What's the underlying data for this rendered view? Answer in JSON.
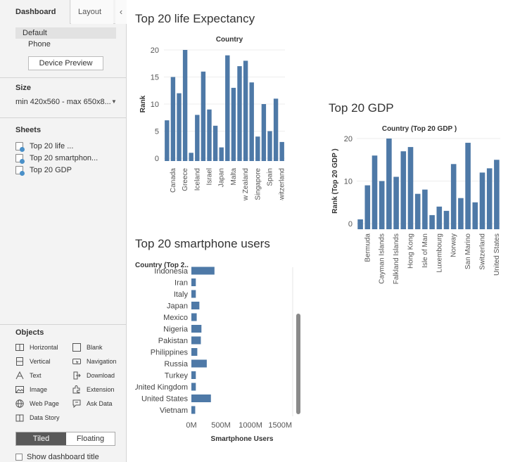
{
  "sidebar": {
    "tabs": {
      "dashboard": "Dashboard",
      "layout": "Layout",
      "collapse_glyph": "‹"
    },
    "device": {
      "default_label": "Default",
      "phone_label": "Phone",
      "preview_button": "Device Preview"
    },
    "size": {
      "title": "Size",
      "value": "min 420x560 - max 650x8...",
      "arrow": "▼"
    },
    "sheets": {
      "title": "Sheets",
      "items": [
        {
          "label": "Top 20 life ..."
        },
        {
          "label": "Top 20 smartphon..."
        },
        {
          "label": "Top 20 GDP"
        }
      ]
    },
    "objects": {
      "title": "Objects",
      "items": [
        {
          "label": "Horizontal",
          "icon": "horizontal-icon"
        },
        {
          "label": "Blank",
          "icon": "blank-icon"
        },
        {
          "label": "Vertical",
          "icon": "vertical-icon"
        },
        {
          "label": "Navigation",
          "icon": "navigation-icon"
        },
        {
          "label": "Text",
          "icon": "text-icon"
        },
        {
          "label": "Download",
          "icon": "download-icon"
        },
        {
          "label": "Image",
          "icon": "image-icon"
        },
        {
          "label": "Extension",
          "icon": "extension-icon"
        },
        {
          "label": "Web Page",
          "icon": "web-page-icon"
        },
        {
          "label": "Ask Data",
          "icon": "ask-data-icon"
        },
        {
          "label": "Data Story",
          "icon": "data-story-icon"
        }
      ]
    },
    "layout_mode": {
      "tiled": "Tiled",
      "floating": "Floating"
    },
    "show_title_label": "Show dashboard title"
  },
  "dashboard": {
    "life_title": "Top 20 life Expectancy",
    "gdp_title": "Top 20 GDP",
    "smart_title": "Top 20 smartphone users"
  },
  "colors": {
    "bar": "#4e79a7",
    "axis": "#555555",
    "grid": "#eeeeee"
  },
  "chart_data": [
    {
      "type": "bar",
      "title": "Country",
      "ylabel": "Rank",
      "ylim": [
        0,
        20
      ],
      "yticks": [
        0,
        5,
        10,
        15,
        20
      ],
      "tick_labels": [
        "Canada",
        "Greece",
        "Iceland",
        "Israel",
        "Japan",
        "Malta",
        "New Zealand",
        "Singapore",
        "Spain",
        "Switzerland"
      ],
      "values": [
        7,
        15,
        12,
        20,
        1,
        8,
        16,
        9,
        6,
        2,
        19,
        13,
        17,
        18,
        14,
        4,
        10,
        5,
        11,
        3
      ]
    },
    {
      "type": "bar",
      "title": "Country (Top 20 GDP )",
      "ylabel": "Rank (Top 20 GDP )",
      "ylim": [
        0,
        20
      ],
      "yticks": [
        0,
        10,
        20
      ],
      "tick_labels": [
        "Bermuda",
        "Cayman Islands",
        "Falkland Islands",
        "Hong Kong",
        "Isle of Man",
        "Luxembourg",
        "Norway",
        "San Marino",
        "Switzerland",
        "United States"
      ],
      "values": [
        1,
        9,
        16,
        10,
        20,
        11,
        17,
        18,
        7,
        8,
        2,
        4,
        3,
        14,
        6,
        19,
        5,
        12,
        13,
        15
      ]
    },
    {
      "type": "bar",
      "orientation": "horizontal",
      "category_header": "Country (Top 2..",
      "xlabel": "Smartphone Users",
      "xlim": [
        0,
        1700000000
      ],
      "xticks": [
        "0M",
        "500M",
        "1000M",
        "1500M"
      ],
      "categories": [
        "Indonesia",
        "Iran",
        "Italy",
        "Japan",
        "Mexico",
        "Nigeria",
        "Pakistan",
        "Philippines",
        "Russia",
        "Turkey",
        "United Kingdom",
        "United States",
        "Vietnam"
      ],
      "values": [
        390000000,
        75000000,
        75000000,
        135000000,
        90000000,
        170000000,
        160000000,
        100000000,
        260000000,
        75000000,
        75000000,
        330000000,
        65000000
      ]
    }
  ]
}
